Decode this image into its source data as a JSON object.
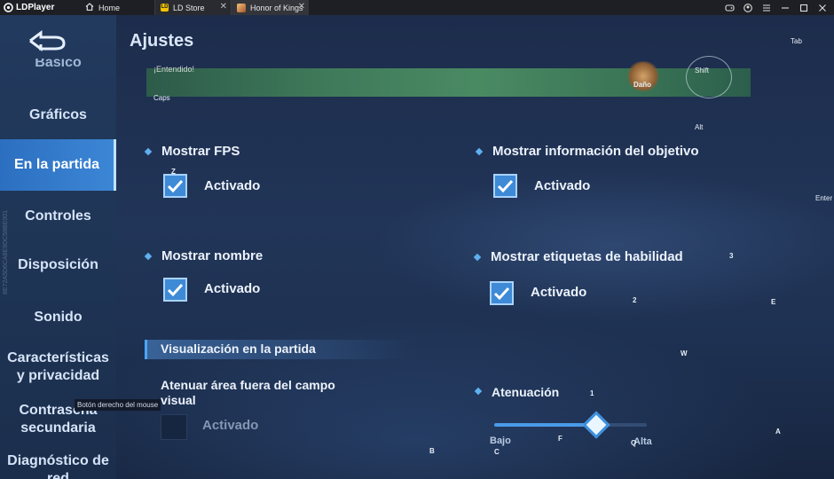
{
  "titlebar": {
    "app_name": "LDPlayer",
    "tabs": [
      {
        "label": "Home",
        "active": false
      },
      {
        "label": "LD Store",
        "active": false,
        "close": "✕"
      },
      {
        "label": "Honor of Kings",
        "active": true,
        "close": "✕"
      }
    ],
    "controls": [
      "gamepad-icon",
      "account-icon",
      "menu-icon",
      "minimize-icon",
      "restore-icon",
      "maximize-icon",
      "close-icon"
    ]
  },
  "sidebar": {
    "partial_top": "Básico",
    "items": [
      {
        "label": "Gráficos",
        "active": false
      },
      {
        "label": "En la partida",
        "active": true
      },
      {
        "label": "Controles",
        "active": false
      },
      {
        "label": "Disposición",
        "active": false
      },
      {
        "label": "Sonido",
        "active": false
      },
      {
        "label": "Características y privacidad",
        "active": false
      },
      {
        "label": "Contraseña secundaria",
        "active": false
      },
      {
        "label": "Diagnóstico de red",
        "active": false
      }
    ],
    "watermark": "8E72A5D6CA8E9DC58BE001"
  },
  "header": {
    "title": "Ajustes"
  },
  "preview": {
    "hint": "¡Entendido!",
    "damage_label": "Daño",
    "shift_label": "Shift"
  },
  "options": {
    "show_fps": {
      "title": "Mostrar FPS",
      "label": "Activado",
      "checked": true
    },
    "show_target_info": {
      "title": "Mostrar información del objetivo",
      "label": "Activado",
      "checked": true
    },
    "show_name": {
      "title": "Mostrar nombre",
      "label": "Activado",
      "checked": true
    },
    "show_skill_labels": {
      "title": "Mostrar etiquetas de habilidad",
      "label": "Activado",
      "checked": true
    },
    "dim_outside_fov": {
      "title": "Atenuar área fuera del campo visual",
      "label": "Activado",
      "checked": false
    }
  },
  "section": {
    "ingame_display": "Visualización en la partida"
  },
  "attenuation": {
    "title": "Atenuación",
    "low_label": "Bajo",
    "high_label": "Alta",
    "value": 0.67
  },
  "tooltip": "Botón derecho del mouse",
  "keys": {
    "tab": "Tab",
    "caps": "Caps",
    "alt": "Alt",
    "enter": "Enter",
    "z": "Z",
    "k3": "3",
    "k2": "2",
    "e": "E",
    "w": "W",
    "k1": "1",
    "a": "A",
    "f": "F",
    "q": "Q",
    "b": "B",
    "c": "C"
  },
  "colors": {
    "accent": "#3e8ad6",
    "active_tab": "#2c6fc0"
  }
}
